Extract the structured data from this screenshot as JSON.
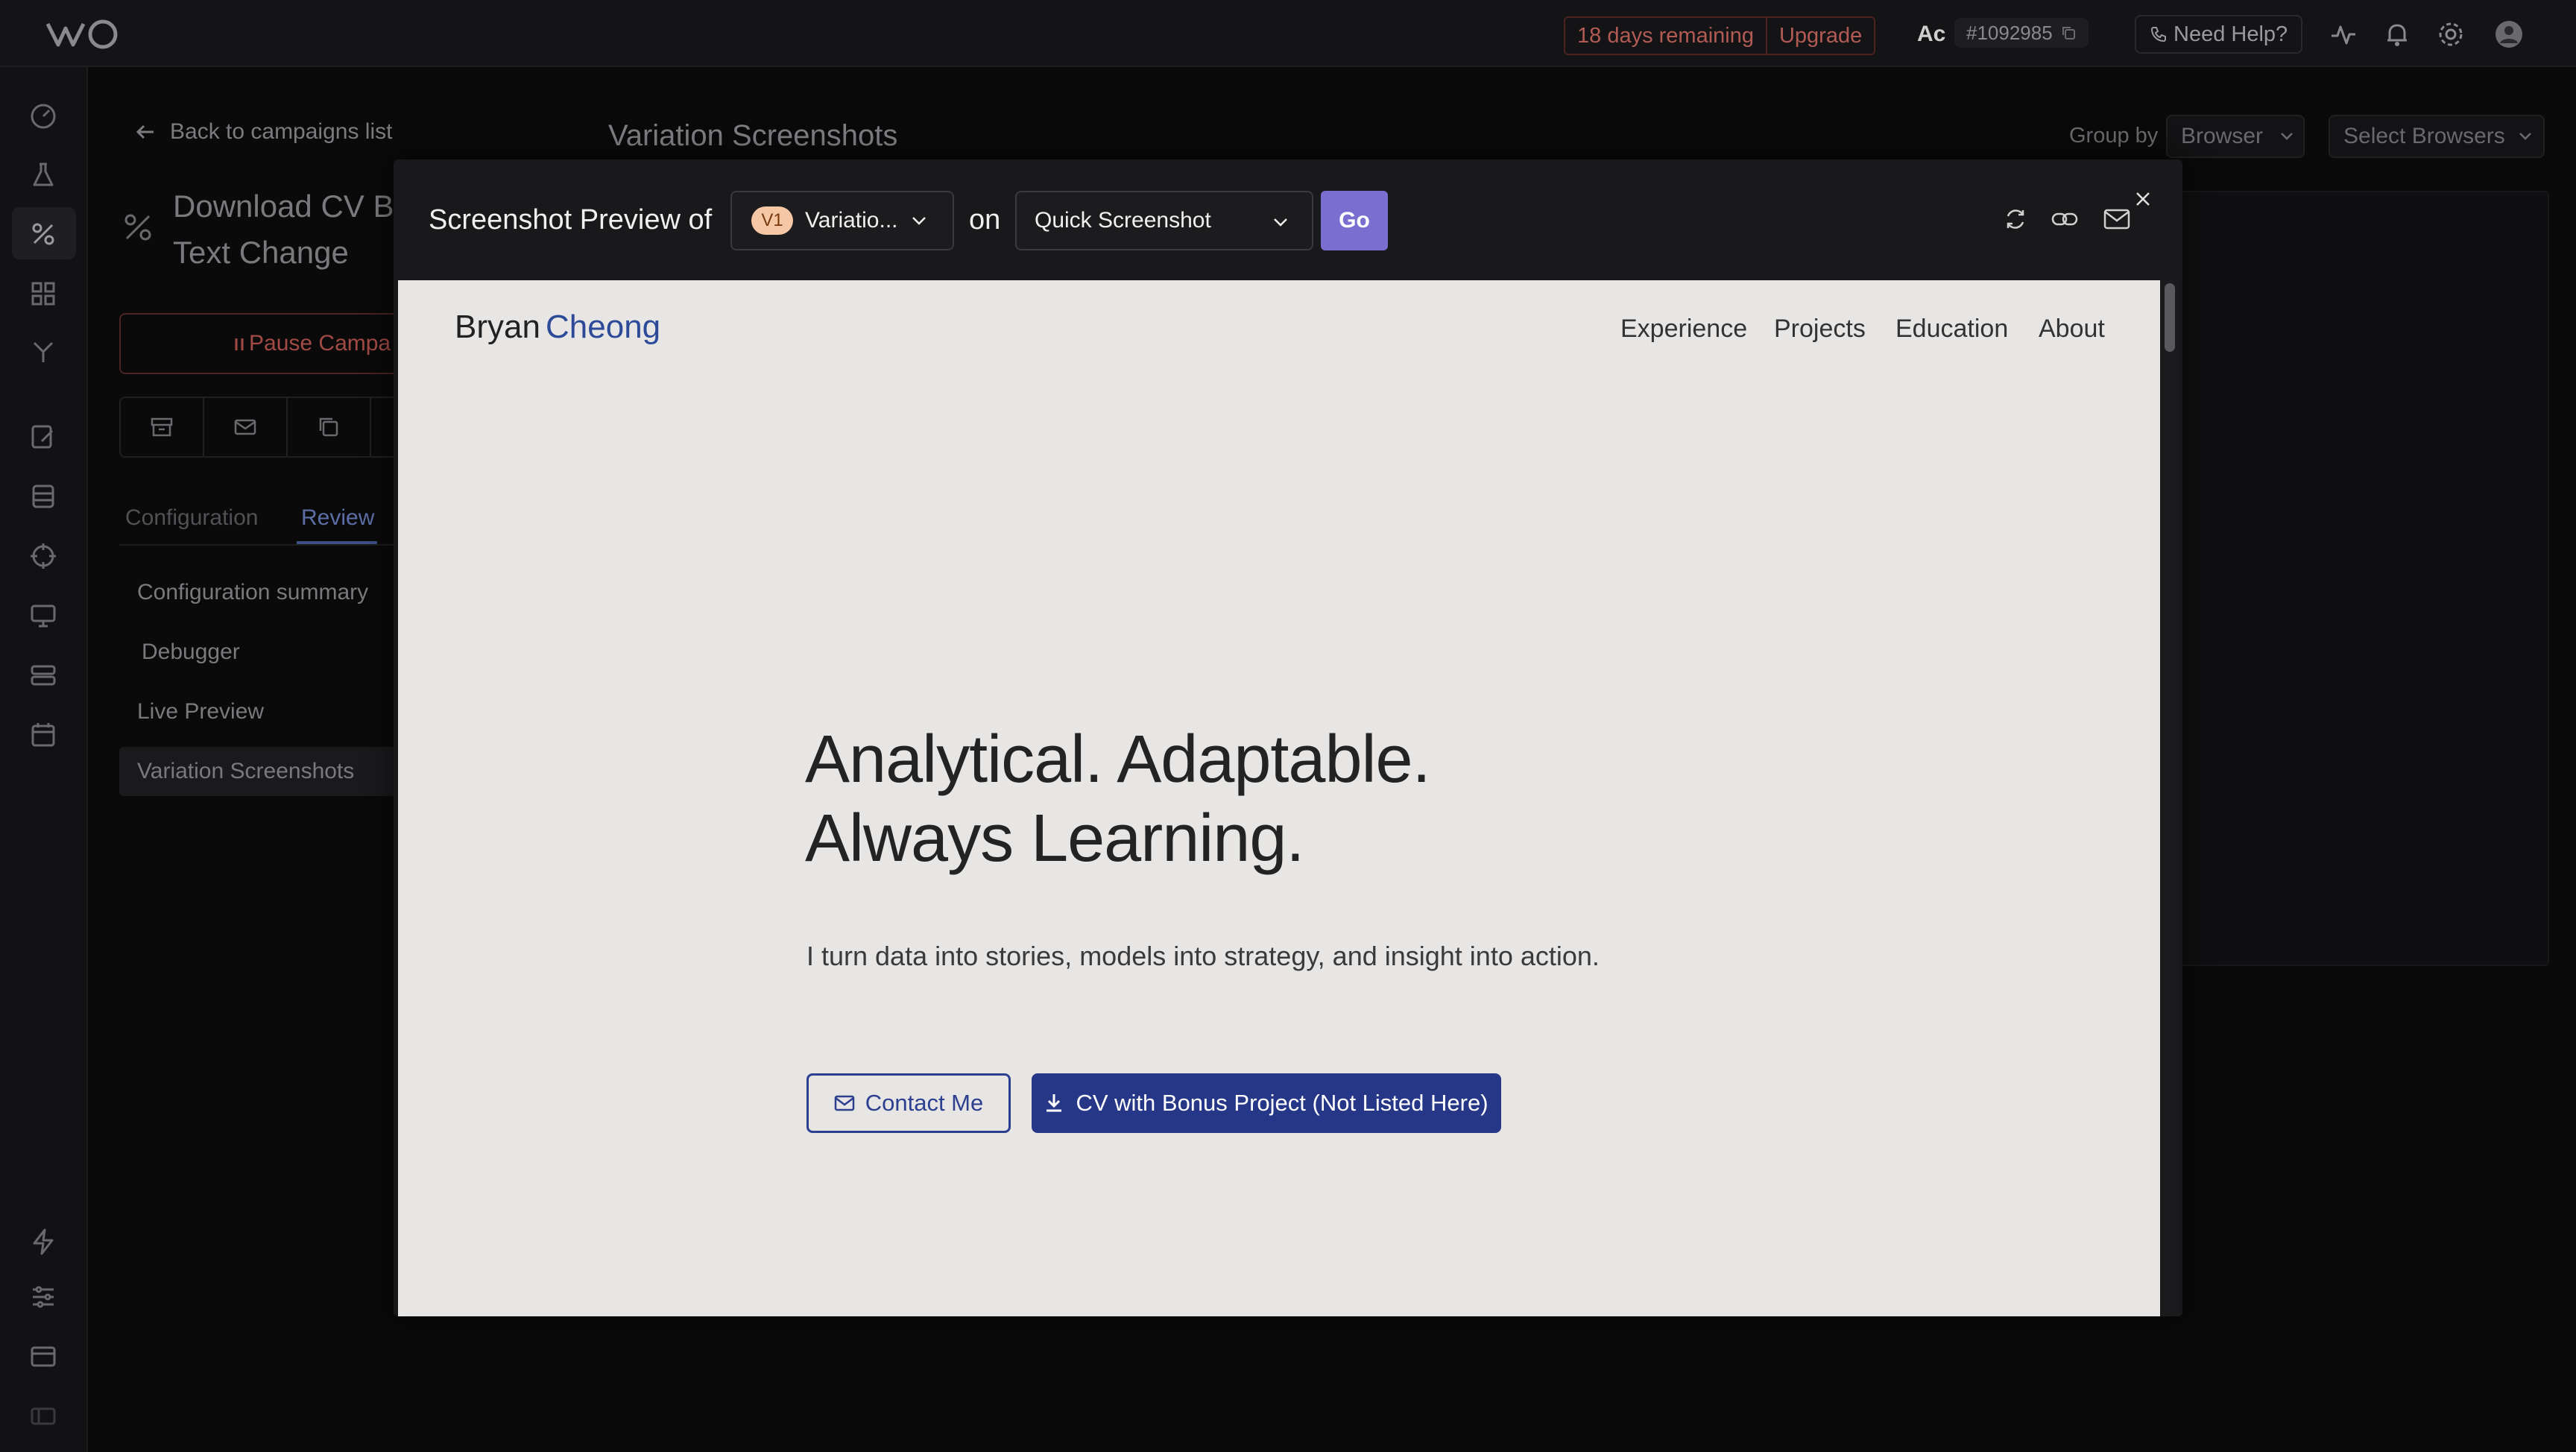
{
  "topbar": {
    "trial_days": "18 days remaining",
    "upgrade": "Upgrade",
    "account_initials": "Ac",
    "account_id": "#1092985",
    "help": "Need Help?"
  },
  "page": {
    "back_link": "Back to campaigns list",
    "title": "Variation Screenshots",
    "group_by_label": "Group by",
    "group_by_value": "Browser",
    "select_browsers": "Select Browsers",
    "campaign_name": "Download CV B Text Change",
    "pause_button": "Pause Campa",
    "tabs": [
      "Configuration",
      "Review"
    ],
    "menu": [
      "Configuration summary",
      "Debugger",
      "Live Preview",
      "Variation Screenshots"
    ]
  },
  "modal": {
    "title": "Screenshot Preview of",
    "variation_badge": "V1",
    "variation_label": "Variatio...",
    "on_word": "on",
    "screenshot_type": "Quick Screenshot",
    "go": "Go"
  },
  "preview": {
    "brand_first": "Bryan",
    "brand_last": "Cheong",
    "nav": [
      "Experience",
      "Projects",
      "Education",
      "About"
    ],
    "hero_line1": "Analytical. Adaptable.",
    "hero_line2": "Always Learning.",
    "subtitle": "I turn data into stories, models into strategy, and insight into action.",
    "contact_button": "Contact Me",
    "cv_button": "CV with Bonus Project (Not Listed Here)"
  },
  "colors": {
    "accent": "#7a6fd0",
    "brand_blue": "#2d4a99",
    "cv_button": "#263787",
    "trial_red": "#b25b55"
  }
}
